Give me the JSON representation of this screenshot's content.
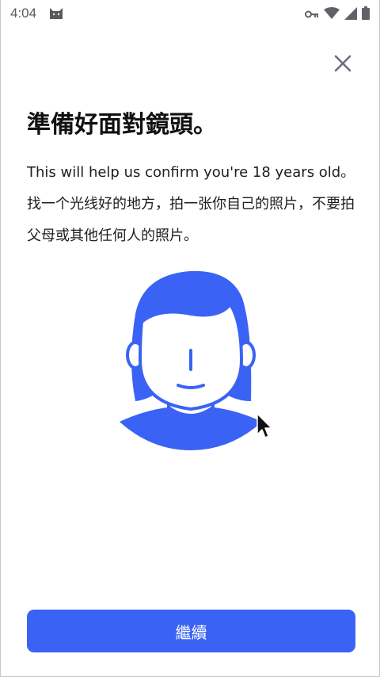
{
  "status_bar": {
    "time": "4:04",
    "icons": [
      "cat-icon",
      "key-icon",
      "wifi-icon",
      "signal-icon",
      "battery-icon"
    ]
  },
  "header": {
    "close_icon": "close-icon"
  },
  "content": {
    "title": "準備好面對鏡頭。",
    "description": "This will help us confirm you're 18 years old。找一个光线好的地方，拍一张你自己的照片，不要拍父母或其他任何人的照片。"
  },
  "illustration": {
    "name": "person-face-illustration",
    "accent_color": "#3a63f5"
  },
  "footer": {
    "continue_label": "繼續"
  },
  "colors": {
    "primary": "#3a63f5",
    "background": "#ffffff",
    "text": "#111111",
    "status_icons": "#5f6368"
  }
}
